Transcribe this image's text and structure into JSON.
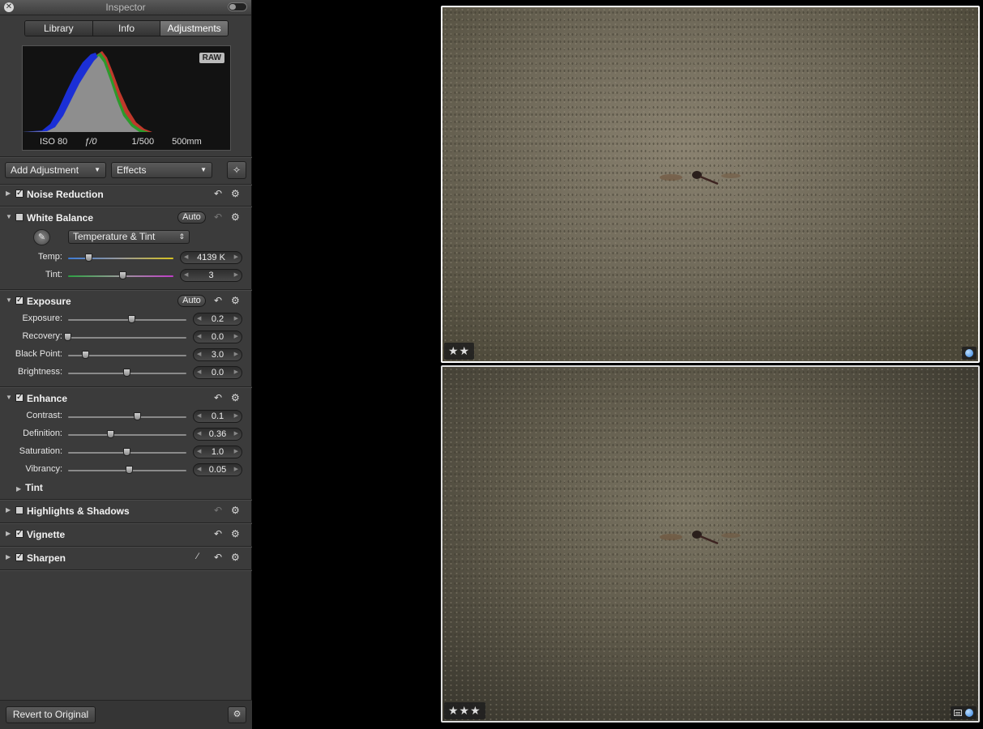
{
  "window": {
    "title": "Inspector"
  },
  "tabs": [
    {
      "label": "Library",
      "active": false
    },
    {
      "label": "Info",
      "active": false
    },
    {
      "label": "Adjustments",
      "active": true
    }
  ],
  "histogram": {
    "badge": "RAW",
    "iso": "ISO 80",
    "aperture": "ƒ/0",
    "shutter": "1/500",
    "focal": "500mm"
  },
  "toolbar": {
    "add_adjustment": "Add Adjustment",
    "effects": "Effects"
  },
  "sections": {
    "noise_reduction": {
      "name": "Noise Reduction",
      "checked": true,
      "expanded": false
    },
    "white_balance": {
      "name": "White Balance",
      "checked": false,
      "expanded": true,
      "auto_label": "Auto",
      "mode": "Temperature & Tint",
      "temp": {
        "label": "Temp:",
        "value": "4139 K",
        "level": 0.2
      },
      "tint": {
        "label": "Tint:",
        "value": "3",
        "level": 0.52
      }
    },
    "exposure": {
      "name": "Exposure",
      "checked": true,
      "expanded": true,
      "auto_label": "Auto",
      "exposure": {
        "label": "Exposure:",
        "value": "0.2",
        "level": 0.54
      },
      "recovery": {
        "label": "Recovery:",
        "value": "0.0",
        "level": 0.0
      },
      "black_point": {
        "label": "Black Point:",
        "value": "3.0",
        "level": 0.15
      },
      "brightness": {
        "label": "Brightness:",
        "value": "0.0",
        "level": 0.5
      }
    },
    "enhance": {
      "name": "Enhance",
      "checked": true,
      "expanded": true,
      "contrast": {
        "label": "Contrast:",
        "value": "0.1",
        "level": 0.59
      },
      "definition": {
        "label": "Definition:",
        "value": "0.36",
        "level": 0.36
      },
      "saturation": {
        "label": "Saturation:",
        "value": "1.0",
        "level": 0.5
      },
      "vibrancy": {
        "label": "Vibrancy:",
        "value": "0.05",
        "level": 0.52
      },
      "tint_sub": "Tint"
    },
    "highlights_shadows": {
      "name": "Highlights & Shadows",
      "checked": false,
      "expanded": false
    },
    "vignette": {
      "name": "Vignette",
      "checked": true,
      "expanded": false
    },
    "sharpen": {
      "name": "Sharpen",
      "checked": true,
      "expanded": false
    }
  },
  "footer": {
    "revert": "Revert to Original"
  },
  "icons": {
    "close": "close-icon",
    "reset": "reset-arrow-icon",
    "gear": "gear-icon",
    "eyedropper": "eyedropper-icon",
    "magic": "magic-wand-icon",
    "brush": "brush-icon"
  },
  "photos": [
    {
      "rating": "★★",
      "badges": [
        "blue-dot"
      ]
    },
    {
      "rating": "★★★",
      "badges": [
        "adjusted",
        "blue-dot"
      ]
    }
  ],
  "colors": {
    "accent_dot": "#2d7fe0",
    "panel": "#3b3b3b"
  }
}
